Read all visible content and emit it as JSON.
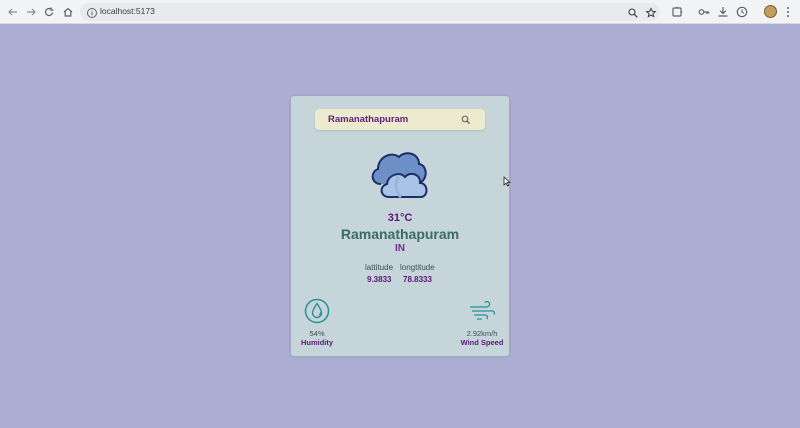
{
  "browser": {
    "url": "localhost:5173"
  },
  "search": {
    "value": "Ramanathapuram"
  },
  "weather": {
    "icon": "cloud-icon",
    "temperature": "31°C",
    "city": "Ramanathapuram",
    "country": "IN"
  },
  "coordinates": {
    "latitude_label": "lattitude",
    "longitude_label": "longtitude",
    "latitude": "9.3833",
    "longitude": "78.8333"
  },
  "humidity": {
    "icon": "humidity-icon",
    "value": "54%",
    "label": "Humidity"
  },
  "wind": {
    "icon": "wind-icon",
    "value": "2.92km/h",
    "label": "Wind Speed"
  },
  "colors": {
    "page_bg": "#abaed2",
    "card_bg": "#c5d5da",
    "search_bg": "#ecebd0",
    "accent_purple": "#5d1778",
    "city_green": "#3c6c63"
  }
}
